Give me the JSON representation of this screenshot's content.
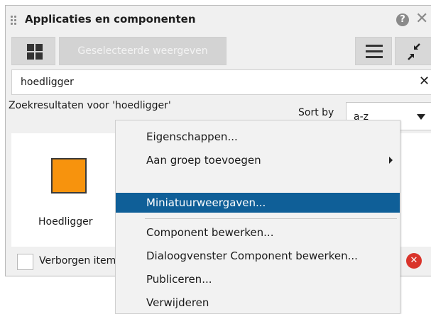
{
  "panel": {
    "title": "Applicaties en componenten",
    "help_icon": "?",
    "close_icon": "✕"
  },
  "toolbar": {
    "thumbnails_icon": "grid-icon",
    "selected_button": "Geselecteerde weergeven",
    "list_icon": "list-icon",
    "collapse_icon": "collapse-icon"
  },
  "search": {
    "value": "hoedligger",
    "clear_icon": "✕"
  },
  "results": {
    "label": "Zoekresultaten voor 'hoedligger'",
    "sort_label": "Sort by",
    "sort_value": "a-z",
    "items": [
      {
        "label": "Hoedligger",
        "color": "#f7930d"
      }
    ]
  },
  "footer": {
    "checkbox_label": "Verborgen items",
    "error_icon": "✕"
  },
  "context_menu": {
    "items": [
      {
        "label": "Eigenschappen..."
      },
      {
        "label": "Aan groep toevoegen",
        "submenu": true
      },
      {
        "label": "Miniatuurweergaven...",
        "highlighted": true
      },
      {
        "label": "Component bewerken..."
      },
      {
        "label": "Dialoogvenster Component bewerken..."
      },
      {
        "label": "Publiceren..."
      },
      {
        "label": "Verwijderen"
      }
    ]
  },
  "colors": {
    "highlight": "#0f5f98",
    "swatch": "#f7930d",
    "error": "#d9342b"
  }
}
